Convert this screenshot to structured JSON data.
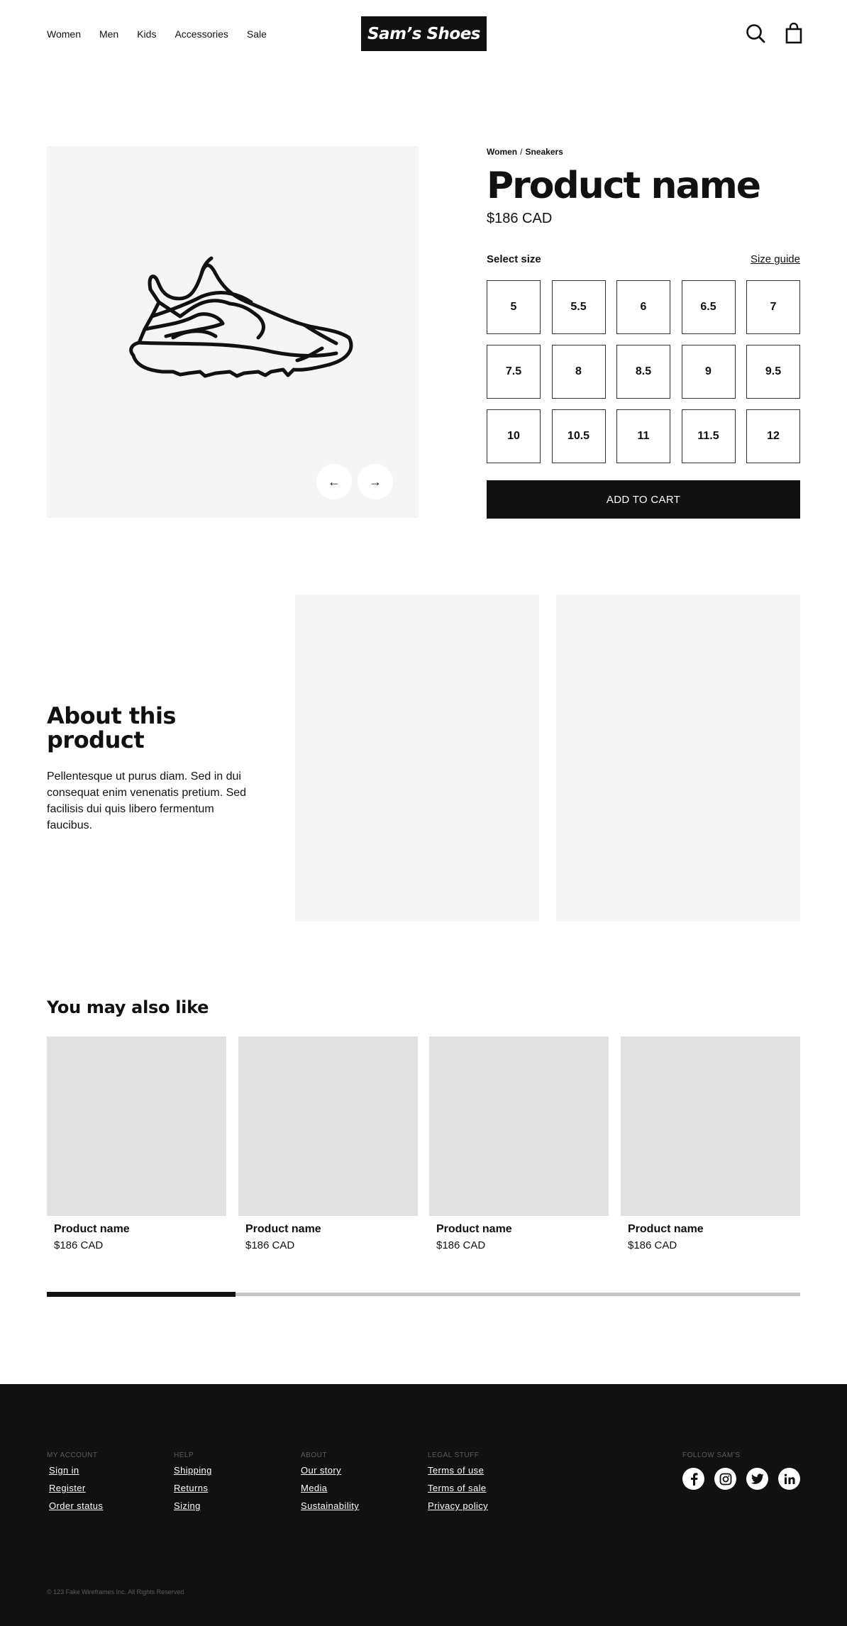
{
  "header": {
    "nav": [
      "Women",
      "Men",
      "Kids",
      "Accessories",
      "Sale"
    ],
    "logo": "Sam’s Shoes",
    "icons": {
      "search": "search-icon",
      "bag": "shopping-bag-icon"
    }
  },
  "product": {
    "breadcrumb": [
      "Women",
      "Sneakers"
    ],
    "breadcrumb_sep": "/",
    "title": "Product name",
    "price": "$186 CAD",
    "size_label": "Select size",
    "size_guide": "Size guide",
    "sizes": [
      "5",
      "5.5",
      "6",
      "6.5",
      "7",
      "7.5",
      "8",
      "8.5",
      "9",
      "9.5",
      "10",
      "10.5",
      "11",
      "11.5",
      "12"
    ],
    "add_to_cart": "ADD TO CART",
    "prev_arrow": "←",
    "next_arrow": "→"
  },
  "about": {
    "title": "About this product",
    "text": "Pellentesque ut purus diam. Sed in dui consequat enim venenatis pretium. Sed facilisis dui quis libero fermentum faucibus."
  },
  "related": {
    "title": "You may also like",
    "items": [
      {
        "name": "Product name",
        "price": "$186 CAD"
      },
      {
        "name": "Product name",
        "price": "$186 CAD"
      },
      {
        "name": "Product name",
        "price": "$186 CAD"
      },
      {
        "name": "Product name",
        "price": "$186 CAD"
      }
    ],
    "scroll_progress": 0.25
  },
  "footer": {
    "columns": [
      {
        "heading": "MY ACCOUNT",
        "links": [
          "Sign in",
          "Register",
          "Order status"
        ]
      },
      {
        "heading": "HELP",
        "links": [
          "Shipping",
          "Returns",
          "Sizing"
        ]
      },
      {
        "heading": "ABOUT",
        "links": [
          "Our story",
          "Media",
          "Sustainability"
        ]
      },
      {
        "heading": "LEGAL STUFF",
        "links": [
          "Terms of use",
          "Terms of sale",
          "Privacy policy"
        ]
      }
    ],
    "social_heading": "FOLLOW SAM’S",
    "social": [
      "facebook-icon",
      "instagram-icon",
      "twitter-icon",
      "linkedin-icon"
    ],
    "copyright": "© 123 Fake Wireframes Inc. All Rights Reserved"
  },
  "colors": {
    "primary": "#111111",
    "surface": "#f5f5f5",
    "card": "#e1e1e1",
    "muted": "#5c5c5c"
  }
}
